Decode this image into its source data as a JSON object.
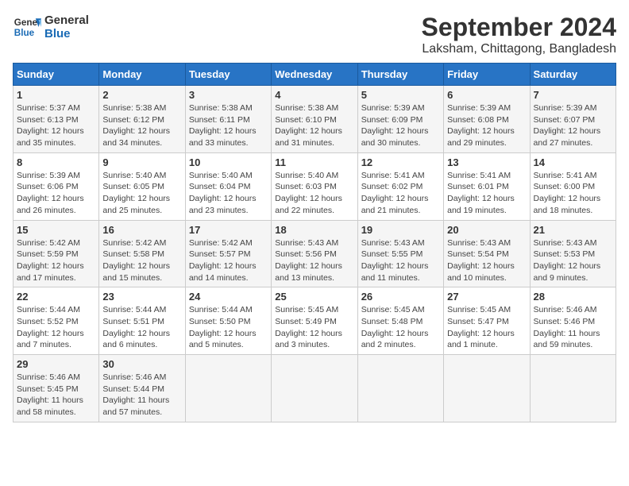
{
  "logo": {
    "line1": "General",
    "line2": "Blue"
  },
  "title": "September 2024",
  "subtitle": "Laksham, Chittagong, Bangladesh",
  "headers": [
    "Sunday",
    "Monday",
    "Tuesday",
    "Wednesday",
    "Thursday",
    "Friday",
    "Saturday"
  ],
  "weeks": [
    [
      {
        "day": "1",
        "detail": "Sunrise: 5:37 AM\nSunset: 6:13 PM\nDaylight: 12 hours\nand 35 minutes."
      },
      {
        "day": "2",
        "detail": "Sunrise: 5:38 AM\nSunset: 6:12 PM\nDaylight: 12 hours\nand 34 minutes."
      },
      {
        "day": "3",
        "detail": "Sunrise: 5:38 AM\nSunset: 6:11 PM\nDaylight: 12 hours\nand 33 minutes."
      },
      {
        "day": "4",
        "detail": "Sunrise: 5:38 AM\nSunset: 6:10 PM\nDaylight: 12 hours\nand 31 minutes."
      },
      {
        "day": "5",
        "detail": "Sunrise: 5:39 AM\nSunset: 6:09 PM\nDaylight: 12 hours\nand 30 minutes."
      },
      {
        "day": "6",
        "detail": "Sunrise: 5:39 AM\nSunset: 6:08 PM\nDaylight: 12 hours\nand 29 minutes."
      },
      {
        "day": "7",
        "detail": "Sunrise: 5:39 AM\nSunset: 6:07 PM\nDaylight: 12 hours\nand 27 minutes."
      }
    ],
    [
      {
        "day": "8",
        "detail": "Sunrise: 5:39 AM\nSunset: 6:06 PM\nDaylight: 12 hours\nand 26 minutes."
      },
      {
        "day": "9",
        "detail": "Sunrise: 5:40 AM\nSunset: 6:05 PM\nDaylight: 12 hours\nand 25 minutes."
      },
      {
        "day": "10",
        "detail": "Sunrise: 5:40 AM\nSunset: 6:04 PM\nDaylight: 12 hours\nand 23 minutes."
      },
      {
        "day": "11",
        "detail": "Sunrise: 5:40 AM\nSunset: 6:03 PM\nDaylight: 12 hours\nand 22 minutes."
      },
      {
        "day": "12",
        "detail": "Sunrise: 5:41 AM\nSunset: 6:02 PM\nDaylight: 12 hours\nand 21 minutes."
      },
      {
        "day": "13",
        "detail": "Sunrise: 5:41 AM\nSunset: 6:01 PM\nDaylight: 12 hours\nand 19 minutes."
      },
      {
        "day": "14",
        "detail": "Sunrise: 5:41 AM\nSunset: 6:00 PM\nDaylight: 12 hours\nand 18 minutes."
      }
    ],
    [
      {
        "day": "15",
        "detail": "Sunrise: 5:42 AM\nSunset: 5:59 PM\nDaylight: 12 hours\nand 17 minutes."
      },
      {
        "day": "16",
        "detail": "Sunrise: 5:42 AM\nSunset: 5:58 PM\nDaylight: 12 hours\nand 15 minutes."
      },
      {
        "day": "17",
        "detail": "Sunrise: 5:42 AM\nSunset: 5:57 PM\nDaylight: 12 hours\nand 14 minutes."
      },
      {
        "day": "18",
        "detail": "Sunrise: 5:43 AM\nSunset: 5:56 PM\nDaylight: 12 hours\nand 13 minutes."
      },
      {
        "day": "19",
        "detail": "Sunrise: 5:43 AM\nSunset: 5:55 PM\nDaylight: 12 hours\nand 11 minutes."
      },
      {
        "day": "20",
        "detail": "Sunrise: 5:43 AM\nSunset: 5:54 PM\nDaylight: 12 hours\nand 10 minutes."
      },
      {
        "day": "21",
        "detail": "Sunrise: 5:43 AM\nSunset: 5:53 PM\nDaylight: 12 hours\nand 9 minutes."
      }
    ],
    [
      {
        "day": "22",
        "detail": "Sunrise: 5:44 AM\nSunset: 5:52 PM\nDaylight: 12 hours\nand 7 minutes."
      },
      {
        "day": "23",
        "detail": "Sunrise: 5:44 AM\nSunset: 5:51 PM\nDaylight: 12 hours\nand 6 minutes."
      },
      {
        "day": "24",
        "detail": "Sunrise: 5:44 AM\nSunset: 5:50 PM\nDaylight: 12 hours\nand 5 minutes."
      },
      {
        "day": "25",
        "detail": "Sunrise: 5:45 AM\nSunset: 5:49 PM\nDaylight: 12 hours\nand 3 minutes."
      },
      {
        "day": "26",
        "detail": "Sunrise: 5:45 AM\nSunset: 5:48 PM\nDaylight: 12 hours\nand 2 minutes."
      },
      {
        "day": "27",
        "detail": "Sunrise: 5:45 AM\nSunset: 5:47 PM\nDaylight: 12 hours\nand 1 minute."
      },
      {
        "day": "28",
        "detail": "Sunrise: 5:46 AM\nSunset: 5:46 PM\nDaylight: 11 hours\nand 59 minutes."
      }
    ],
    [
      {
        "day": "29",
        "detail": "Sunrise: 5:46 AM\nSunset: 5:45 PM\nDaylight: 11 hours\nand 58 minutes."
      },
      {
        "day": "30",
        "detail": "Sunrise: 5:46 AM\nSunset: 5:44 PM\nDaylight: 11 hours\nand 57 minutes."
      },
      {
        "day": "",
        "detail": ""
      },
      {
        "day": "",
        "detail": ""
      },
      {
        "day": "",
        "detail": ""
      },
      {
        "day": "",
        "detail": ""
      },
      {
        "day": "",
        "detail": ""
      }
    ]
  ]
}
